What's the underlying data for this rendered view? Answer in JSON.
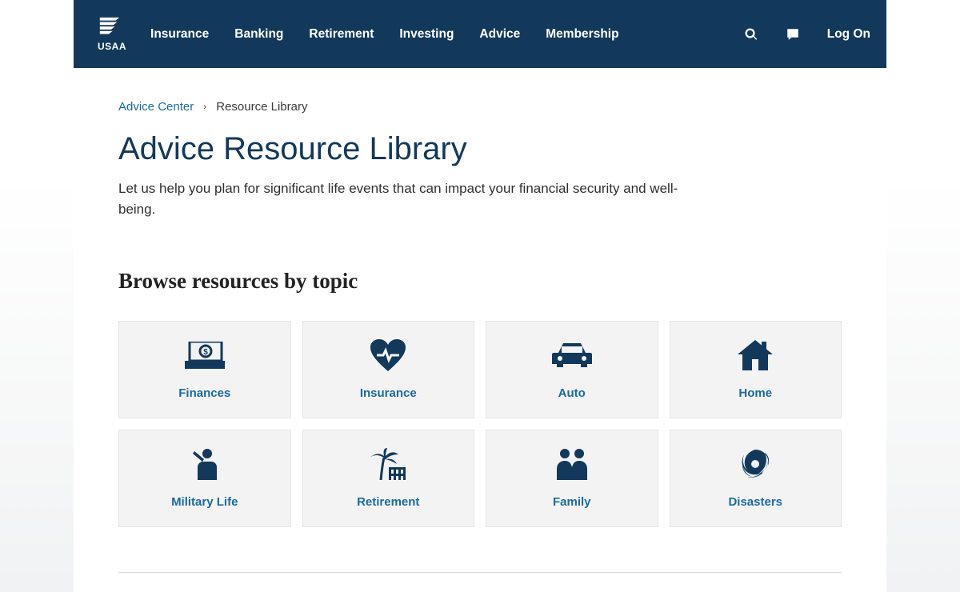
{
  "brand": {
    "name": "USAA"
  },
  "nav": {
    "items": [
      {
        "label": "Insurance"
      },
      {
        "label": "Banking"
      },
      {
        "label": "Retirement"
      },
      {
        "label": "Investing"
      },
      {
        "label": "Advice"
      },
      {
        "label": "Membership"
      }
    ],
    "logon": "Log On"
  },
  "breadcrumb": {
    "parent": "Advice Center",
    "current": "Resource Library"
  },
  "page": {
    "title": "Advice Resource Library",
    "subtitle": "Let us help you plan for significant life events that can impact your financial security and well-being."
  },
  "section": {
    "heading": "Browse resources by topic"
  },
  "topics": [
    {
      "label": "Finances",
      "icon": "money-icon"
    },
    {
      "label": "Insurance",
      "icon": "heart-pulse-icon"
    },
    {
      "label": "Auto",
      "icon": "car-icon"
    },
    {
      "label": "Home",
      "icon": "house-icon"
    },
    {
      "label": "Military Life",
      "icon": "salute-icon"
    },
    {
      "label": "Retirement",
      "icon": "palm-chair-icon"
    },
    {
      "label": "Family",
      "icon": "family-icon"
    },
    {
      "label": "Disasters",
      "icon": "hurricane-icon"
    }
  ],
  "colors": {
    "brand_navy": "#12395b",
    "link_blue": "#1a6b9f",
    "card_bg": "#f3f3f3"
  }
}
